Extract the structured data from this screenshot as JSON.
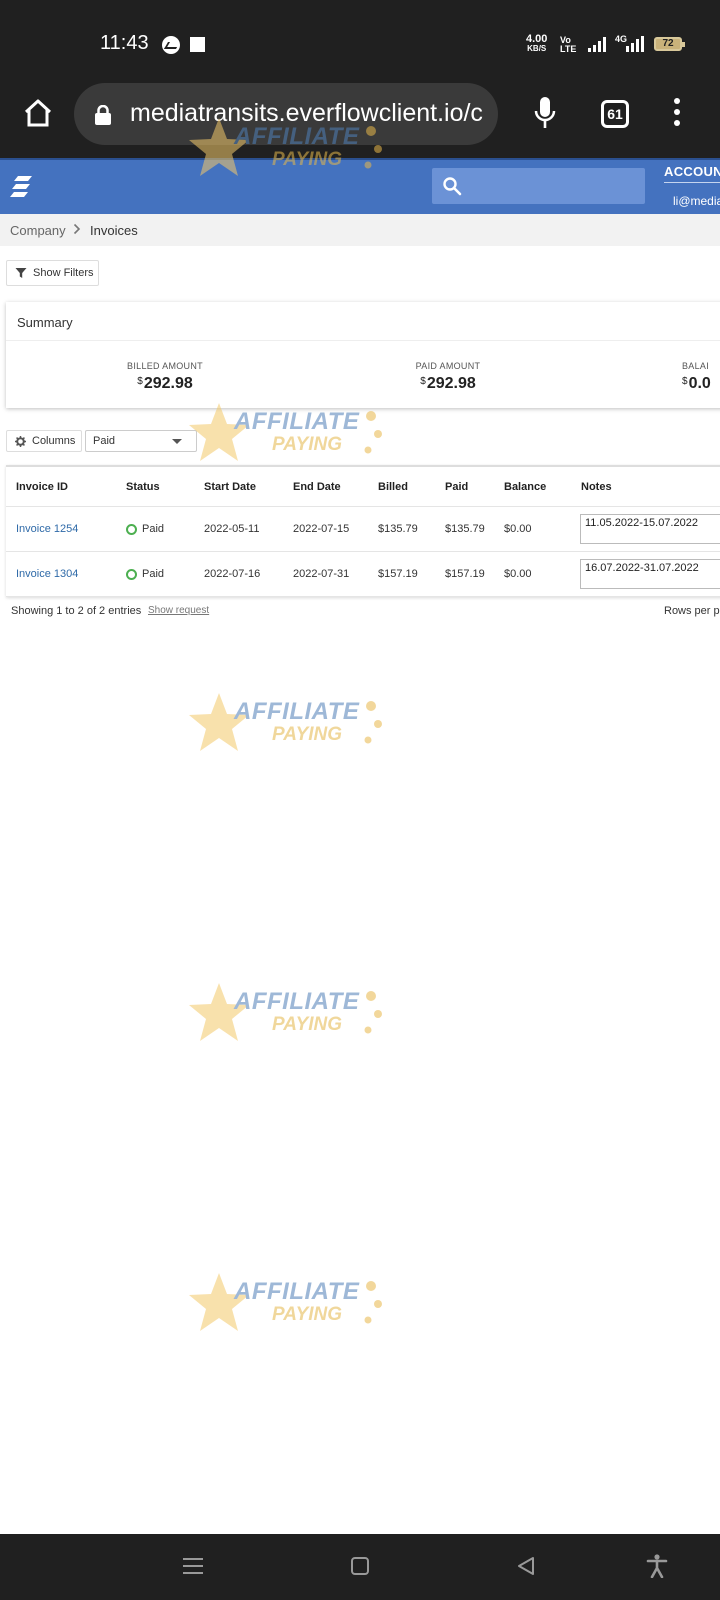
{
  "status_bar": {
    "time": "11:43",
    "net_speed_value": "4.00",
    "net_speed_unit": "KB/S",
    "volte_line1": "Vo",
    "volte_line2": "LTE",
    "network_type": "4G",
    "battery": "72",
    "icons": [
      "messenger-icon",
      "square-notification-icon",
      "signal-icon",
      "battery-icon"
    ]
  },
  "browser": {
    "url": "mediatransits.everflowclient.io/c",
    "tab_count": "61",
    "icons": [
      "home-icon",
      "lock-icon",
      "mic-icon",
      "tabs-icon",
      "kebab-menu-icon"
    ]
  },
  "header": {
    "account_label": "ACCOUNT",
    "account_email": "li@media",
    "search_placeholder": "",
    "brand_color": "#4472bf"
  },
  "breadcrumb": {
    "items": [
      "Company",
      "Invoices"
    ]
  },
  "filters": {
    "show_filters_label": "Show Filters"
  },
  "summary": {
    "title": "Summary",
    "metrics": [
      {
        "label": "BILLED AMOUNT",
        "currency": "$",
        "value": "292.98"
      },
      {
        "label": "PAID AMOUNT",
        "currency": "$",
        "value": "292.98"
      },
      {
        "label": "BALAI",
        "currency": "$",
        "value": "0.0"
      }
    ]
  },
  "toolbar": {
    "columns_label": "Columns",
    "status_filter_value": "Paid"
  },
  "table": {
    "columns": [
      "Invoice ID",
      "Status",
      "Start Date",
      "End Date",
      "Billed",
      "Paid",
      "Balance",
      "Notes"
    ],
    "rows": [
      {
        "invoice_id": "Invoice 1254",
        "status": "Paid",
        "start_date": "2022-05-11",
        "end_date": "2022-07-15",
        "billed": "$135.79",
        "paid": "$135.79",
        "balance": "$0.00",
        "notes": "11.05.2022-15.07.2022"
      },
      {
        "invoice_id": "Invoice 1304",
        "status": "Paid",
        "start_date": "2022-07-16",
        "end_date": "2022-07-31",
        "billed": "$157.19",
        "paid": "$157.19",
        "balance": "$0.00",
        "notes": "16.07.2022-31.07.2022"
      }
    ],
    "status_color": "#4caf50",
    "link_color": "#2f6aa8"
  },
  "footer": {
    "entries_text": "Showing 1 to 2 of 2 entries",
    "show_request_label": "Show request",
    "rows_per_page_label": "Rows per p"
  },
  "watermark": {
    "line1": "AFFILIATE",
    "line2": "PAYING"
  }
}
